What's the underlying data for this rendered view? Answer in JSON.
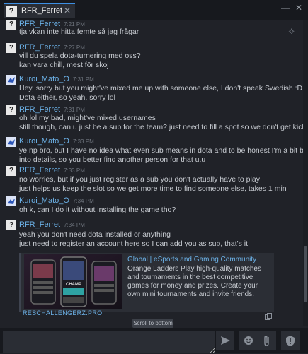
{
  "tab": {
    "avatar_text": "?",
    "name": "RFR_Ferret",
    "close": "✕"
  },
  "window": {
    "minimize": "—",
    "close": "✕"
  },
  "messages": [
    {
      "author": "RFR_Ferret",
      "time": "7:21 PM",
      "lines": [
        "tja vkan inte hitta femte så jag frågar"
      ]
    },
    {
      "author": "RFR_Ferret",
      "time": "7:27 PM",
      "lines": [
        "vill du spela dota-turnering med oss?",
        "kan vara chill, mest för skoj"
      ]
    },
    {
      "author": "Kuroi_Mato_O",
      "time": "7:31 PM",
      "lines": [
        "Hey, sorry but you might've mixed me up with someone else, I don't speak Swedish :D And I don't play",
        "Dota either, so yeah, sorry lol"
      ]
    },
    {
      "author": "RFR_Ferret",
      "time": "7:31 PM",
      "lines": [
        "oh lol my bad, might've mixed usernames",
        "still though, can u just be a sub for the team? just need to fill a spot so we don't get kicked out"
      ]
    },
    {
      "author": "Kuroi_Mato_O",
      "time": "7:33 PM",
      "lines": [
        "ye np bro, but I have no idea what even sub means in dota and to be honest I'm a bit busy rn for dive",
        "into details, so you better find another person for that u.u"
      ]
    },
    {
      "author": "RFR_Ferret",
      "time": "7:33 PM",
      "lines": [
        "no worries, but if you just register as a sub you don't actually have to play",
        "just helps us keep the slot so we get more time to find someone else, takes 1 min"
      ]
    },
    {
      "author": "Kuroi_Mato_O",
      "time": "7:34 PM",
      "lines": [
        "oh k, can I do it without installing the game tho?"
      ]
    },
    {
      "author": "RFR_Ferret",
      "time": "7:34 PM",
      "lines": [
        "yeah you don't need dota installed or anything",
        "just need to register an account here so I can add you as sub, that's it"
      ]
    }
  ],
  "embed": {
    "title": "Global | eSports and Gaming Community",
    "description": "Orange Ladders Play high-quality matches and tournaments in the best competitive games for money and prizes. Create your own mini tournaments and invite friends.",
    "link": "RESCHALLENGERZ.PRO",
    "image_text": "CHAMP"
  },
  "scroll_to_bottom": "Scroll to bottom",
  "composer": {
    "placeholder": ""
  },
  "colors": {
    "accent": "#3d8fe3",
    "link": "#6cb2e8",
    "background": "#202228"
  }
}
